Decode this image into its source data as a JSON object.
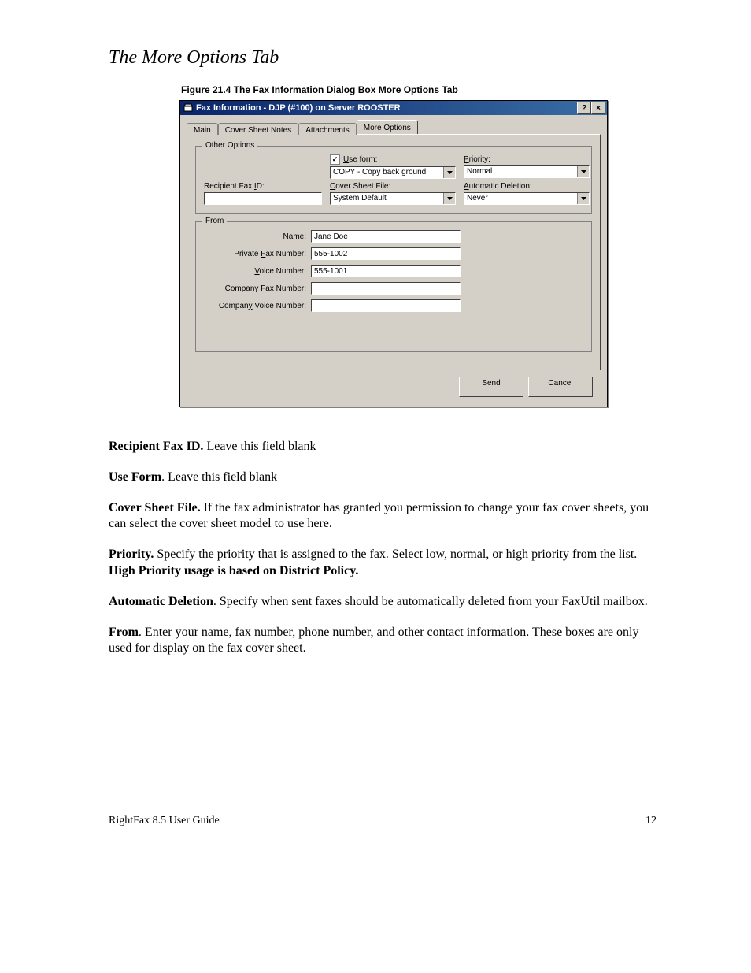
{
  "page": {
    "section_title": "The More Options Tab",
    "figure_caption": "Figure 21.4  The Fax Information Dialog Box More Options Tab",
    "footer_left": "RightFax 8.5 User Guide",
    "footer_right": "12"
  },
  "dialog": {
    "title": "Fax Information - DJP (#100) on Server ROOSTER",
    "help_btn": "?",
    "close_btn": "×",
    "tabs": {
      "main": "Main",
      "cover": "Cover Sheet Notes",
      "attachments": "Attachments",
      "more": "More Options"
    },
    "other_options": {
      "group_title": "Other Options",
      "recipient_fax_id_label": "Recipient Fax ID:",
      "recipient_fax_id_value": "",
      "use_form_label": "Use form:",
      "use_form_checked": "✓",
      "use_form_value": "COPY - Copy back ground",
      "cover_sheet_label": "Cover Sheet File:",
      "cover_sheet_value": "System Default",
      "priority_label": "Priority:",
      "priority_value": "Normal",
      "auto_delete_label": "Automatic Deletion:",
      "auto_delete_value": "Never"
    },
    "from": {
      "group_title": "From",
      "name_label": "Name:",
      "name_value": "Jane Doe",
      "private_fax_label": "Private Fax Number:",
      "private_fax_value": "555-1002",
      "voice_label": "Voice Number:",
      "voice_value": "555-1001",
      "company_fax_label": "Company Fax Number:",
      "company_fax_value": "",
      "company_voice_label": "Company Voice Number:",
      "company_voice_value": ""
    },
    "buttons": {
      "send": "Send",
      "cancel": "Cancel"
    }
  },
  "copy": {
    "p1a": "Recipient Fax ID.",
    "p1b": "  Leave this field blank",
    "p2a": "Use Form",
    "p2b": ". Leave this field blank",
    "p3a": "Cover Sheet File.",
    "p3b": " If the fax administrator has granted you permission to change your fax cover sheets, you can select the cover sheet model to use here.",
    "p4a": "Priority.",
    "p4b": " Specify the priority that is assigned to the fax. Select low, normal, or high priority from the list.  ",
    "p4c": "High Priority usage is based on District Policy.",
    "p5a": "Automatic Deletion",
    "p5b": ". Specify when sent faxes should be automatically deleted from your FaxUtil mailbox.",
    "p6a": "From",
    "p6b": ". Enter your name, fax number, phone number, and other contact information. These boxes are only used for display on the fax cover sheet."
  }
}
